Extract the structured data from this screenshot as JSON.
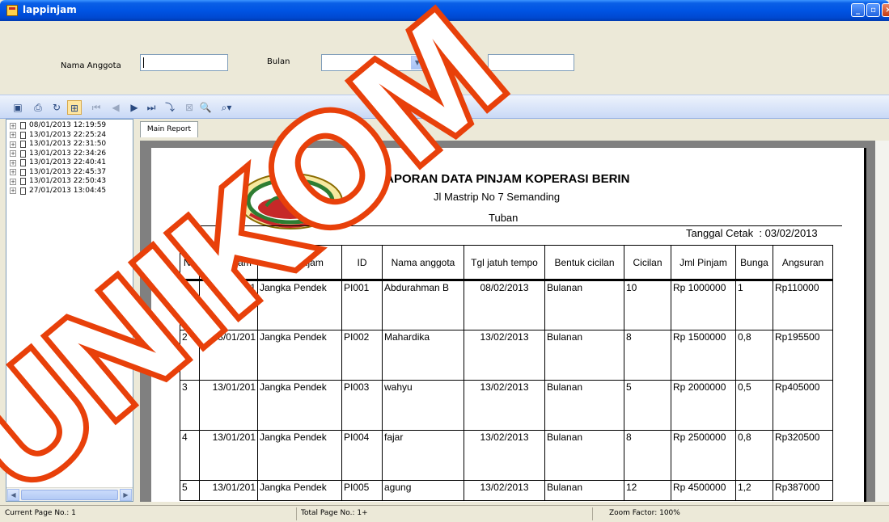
{
  "window": {
    "title": "lappinjam"
  },
  "filters": {
    "nama_label": "Nama Anggota",
    "nama_value": "",
    "bulan_label": "Bulan",
    "bulan_value": "",
    "tahun_label": "Tahun",
    "tahun_value": ""
  },
  "toolbar": {
    "icons": [
      "export-icon",
      "print-icon",
      "refresh-icon",
      "group-tree-icon",
      "first-page-icon",
      "previous-page-icon",
      "next-page-icon",
      "last-page-icon",
      "goto-page-icon",
      "close-view-icon",
      "search-icon",
      "zoom-icon"
    ]
  },
  "tree": {
    "items": [
      "08/01/2013 12:19:59",
      "13/01/2013 22:25:24",
      "13/01/2013 22:31:50",
      "13/01/2013 22:34:26",
      "13/01/2013 22:40:41",
      "13/01/2013 22:45:37",
      "13/01/2013 22:50:43",
      "27/01/2013 13:04:45"
    ]
  },
  "report": {
    "tab": "Main Report",
    "title": "LAPORAN DATA PINJAM KOPERASI BERIN",
    "address": "Jl Mastrip No 7 Semanding",
    "city": "Tuban",
    "print_date_label": "Tanggal Cetak  :",
    "print_date": "03/02/2013",
    "columns": [
      "No",
      "Tgl Pinjam",
      "Jns Pinjam",
      "ID",
      "Nama anggota",
      "Tgl jatuh tempo",
      "Bentuk cicilan",
      "Cicilan",
      "Jml Pinjam",
      "Bunga",
      "Angsuran"
    ],
    "rows": [
      [
        "1",
        "08/01/201",
        "Jangka Pendek",
        "PI001",
        "Abdurahman B",
        "08/02/2013",
        "Bulanan",
        "10",
        "Rp 1000000",
        "1",
        "Rp110000"
      ],
      [
        "2",
        "13/01/201",
        "Jangka Pendek",
        "PI002",
        "Mahardika",
        "13/02/2013",
        "Bulanan",
        "8",
        "Rp 1500000",
        "0,8",
        "Rp195500"
      ],
      [
        "3",
        "13/01/201",
        "Jangka Pendek",
        "PI003",
        "wahyu",
        "13/02/2013",
        "Bulanan",
        "5",
        "Rp 2000000",
        "0,5",
        "Rp405000"
      ],
      [
        "4",
        "13/01/201",
        "Jangka Pendek",
        "PI004",
        "fajar",
        "13/02/2013",
        "Bulanan",
        "8",
        "Rp 2500000",
        "0,8",
        "Rp320500"
      ],
      [
        "5",
        "13/01/201",
        "Jangka Pendek",
        "PI005",
        "agung",
        "13/02/2013",
        "Bulanan",
        "12",
        "Rp 4500000",
        "1,2",
        "Rp387000"
      ]
    ]
  },
  "status": {
    "current_page": "Current Page No.: 1",
    "total_page": "Total Page No.: 1+",
    "zoom": "Zoom Factor: 100%"
  },
  "watermark": {
    "text": "UNIKOM",
    "color": "#E8400A"
  },
  "colors": {
    "titlebar": "#0054E3",
    "toolbar": "#C9D9F6"
  }
}
